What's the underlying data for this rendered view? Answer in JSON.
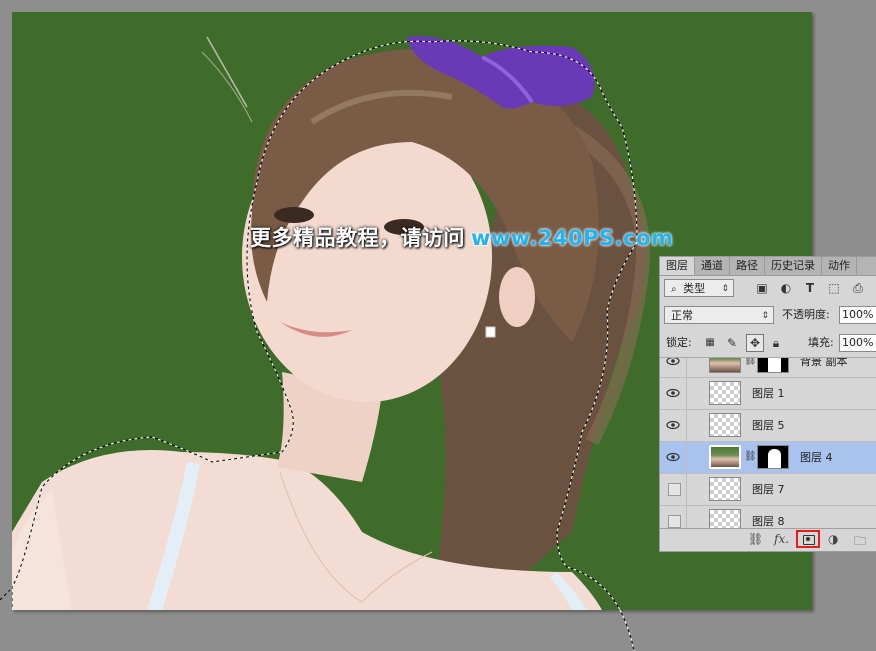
{
  "watermark": {
    "cn_text": "更多精品教程，请访问",
    "url_text": "www.240PS.com"
  },
  "colors": {
    "canvas_bg": "#3f6b2b",
    "workspace_bg": "#8e8e8e",
    "selected_layer_bg": "#a9c3ee",
    "watermark_url": "#22b4f2",
    "highlight_border": "#e41e1e"
  },
  "layers_panel": {
    "tabs": [
      {
        "label": "图层",
        "active": true
      },
      {
        "label": "通道"
      },
      {
        "label": "路径"
      },
      {
        "label": "历史记录"
      },
      {
        "label": "动作"
      }
    ],
    "filter": {
      "label": "类型",
      "icons": [
        "image-filter-icon",
        "adjustment-filter-icon",
        "type-filter-icon",
        "shape-filter-icon",
        "smart-object-filter-icon"
      ]
    },
    "blend_mode": "正常",
    "opacity_label": "不透明度:",
    "opacity_value": "100%",
    "lock_label": "锁定:",
    "fill_label": "填充:",
    "fill_value": "100%",
    "layers": [
      {
        "name": "背景 副本",
        "visible": true,
        "has_mask": true,
        "photo": true
      },
      {
        "name": "图层 1",
        "visible": true,
        "has_mask": false,
        "photo": false
      },
      {
        "name": "图层 5",
        "visible": true,
        "has_mask": false,
        "photo": false
      },
      {
        "name": "图层 4",
        "visible": true,
        "has_mask": true,
        "photo": true,
        "selected": true
      },
      {
        "name": "图层 7",
        "visible": false,
        "has_mask": false,
        "photo": false
      },
      {
        "name": "图层 8",
        "visible": false,
        "has_mask": false,
        "photo": false
      }
    ],
    "bottom_bar": {
      "fx_label": "fx."
    }
  }
}
